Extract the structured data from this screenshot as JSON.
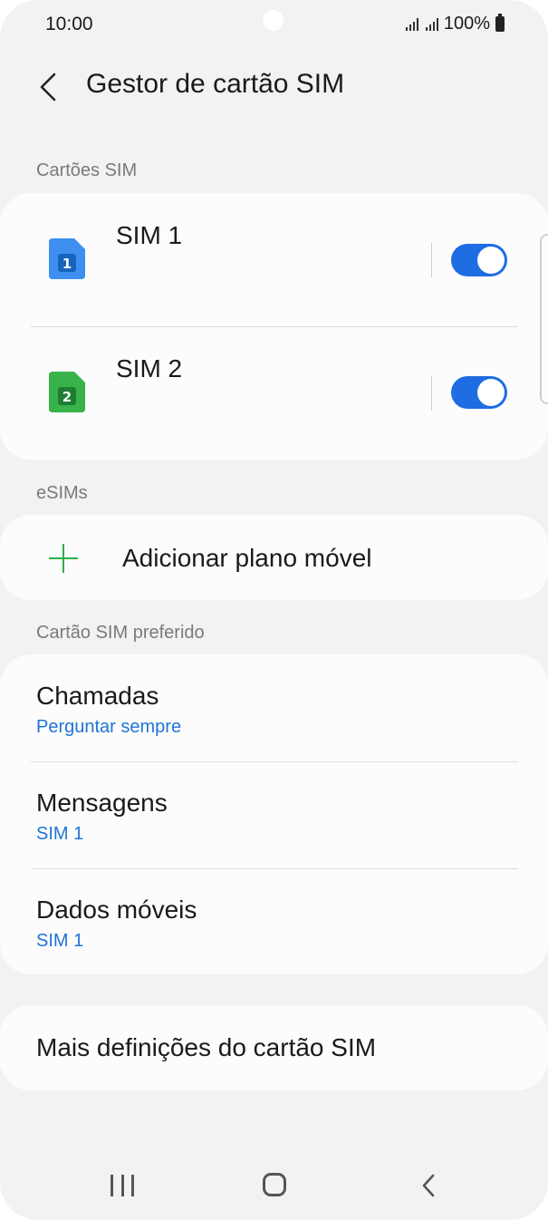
{
  "status_bar": {
    "time": "10:00",
    "battery": "100%"
  },
  "header": {
    "title": "Gestor de cartão SIM"
  },
  "sections": {
    "sim_cards": "Cartões SIM",
    "esims": "eSIMs",
    "preferred": "Cartão SIM preferido"
  },
  "sims": [
    {
      "name": "SIM 1",
      "badge": "1",
      "color": "#3e8ff0",
      "enabled": true
    },
    {
      "name": "SIM 2",
      "badge": "2",
      "color": "#37b34a",
      "enabled": true
    }
  ],
  "esim": {
    "add_label": "Adicionar plano móvel"
  },
  "preferred": [
    {
      "title": "Chamadas",
      "value": "Perguntar sempre"
    },
    {
      "title": "Mensagens",
      "value": "SIM 1"
    },
    {
      "title": "Dados móveis",
      "value": "SIM 1"
    }
  ],
  "more": {
    "label": "Mais definições do cartão SIM"
  },
  "colors": {
    "accent": "#1e6de3",
    "link": "#1f74d6",
    "add": "#2db04b"
  }
}
